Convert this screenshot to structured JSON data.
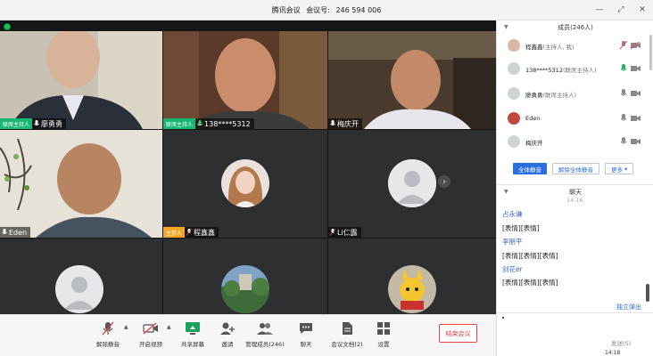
{
  "window": {
    "app_name": "腾讯会议",
    "meeting_id_label": "会议号:",
    "meeting_id": "246 594 006"
  },
  "video_tiles": [
    {
      "name": "廖勇勇",
      "role": "联席主持人"
    },
    {
      "name": "138****5312",
      "role": "联席主持人"
    },
    {
      "name": "梅庆开",
      "role": ""
    },
    {
      "name": "Eden",
      "role": ""
    },
    {
      "name": "程鑫鑫",
      "role": "主持人"
    },
    {
      "name": "Li仁露",
      "role": ""
    }
  ],
  "toolbar": {
    "unmute": "解除静音",
    "start_video": "开启视频",
    "share_screen": "共享屏幕",
    "invite": "邀请",
    "manage_members": "管理成员(246)",
    "chat": "聊天",
    "documents": "会议文档(2)",
    "settings": "设置",
    "end_meeting": "结束会议"
  },
  "members_panel": {
    "title": "成员(246人)",
    "members": [
      {
        "name": "程鑫鑫",
        "note": "(主持人, 我)"
      },
      {
        "name": "138****5312",
        "note": "(联席主持人)"
      },
      {
        "name": "廖勇勇",
        "note": "(联席主持人)"
      },
      {
        "name": "Eden",
        "note": ""
      },
      {
        "name": "梅庆开",
        "note": ""
      }
    ],
    "mute_all": "全体静音",
    "unmute_all": "解除全体静音",
    "more": "更多"
  },
  "chat": {
    "title": "聊天",
    "time": "14:16",
    "messages": [
      {
        "sender": "占永谦",
        "text": "[表情][表情]"
      },
      {
        "sender": "李朋平",
        "text": "[表情][表情][表情]"
      },
      {
        "sender": "剑花er",
        "text": "[表情][表情][表情]"
      }
    ],
    "popout": "独立弹出",
    "send": "发送(S)",
    "clock": "14:18"
  },
  "colors": {
    "cohost_badge": "#19b774",
    "host_badge": "#f5a623",
    "primary_blue": "#2a6fdf",
    "end_red": "#e64545"
  }
}
